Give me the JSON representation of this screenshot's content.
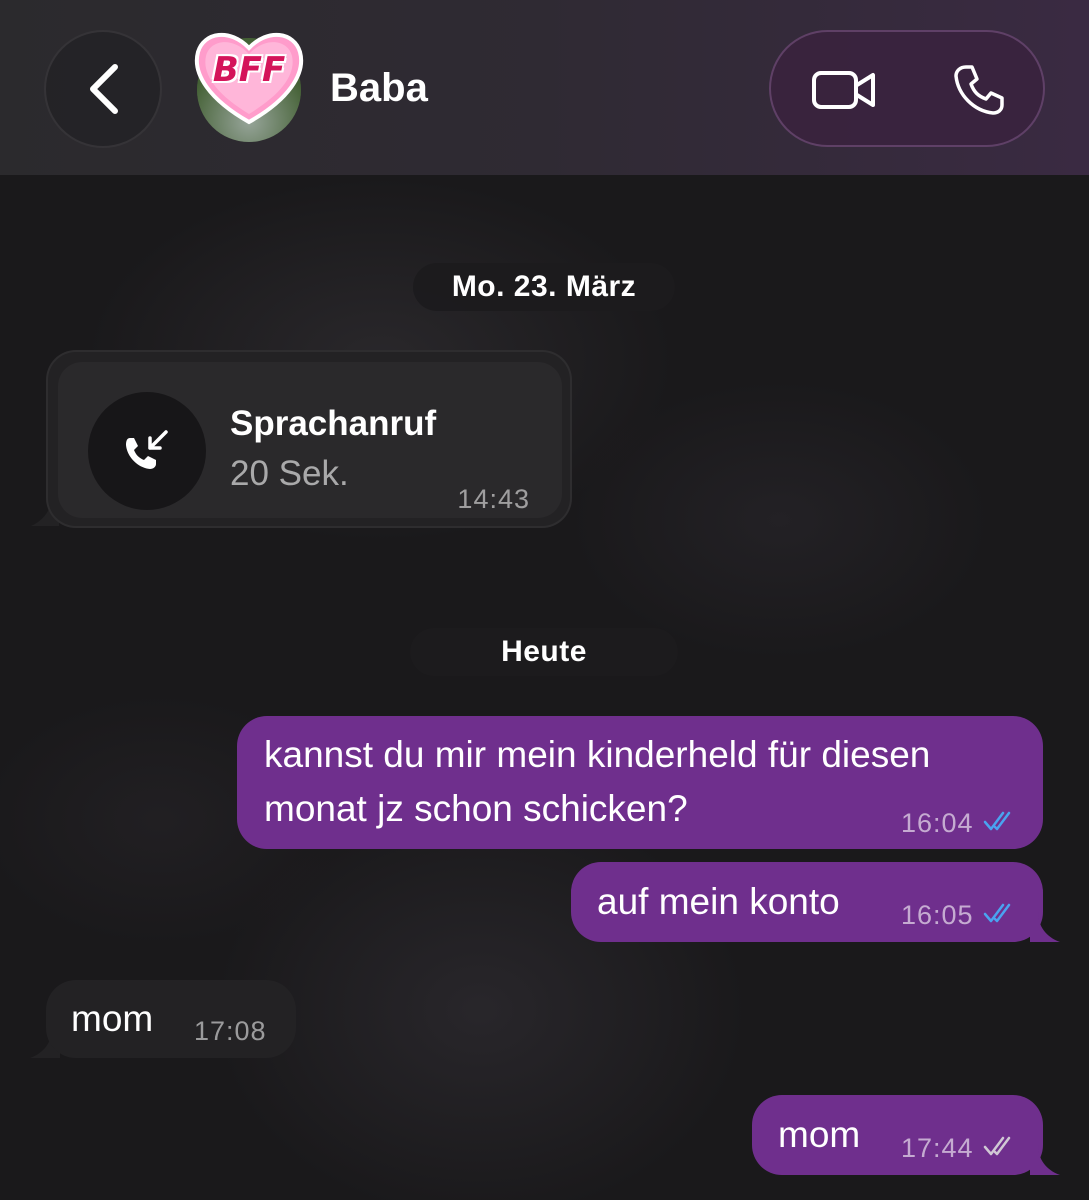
{
  "header": {
    "contact_name": "Baba",
    "avatar_badge_text": "BFF"
  },
  "dates": {
    "first": "Mo. 23. März",
    "second": "Heute"
  },
  "call": {
    "title": "Sprachanruf",
    "duration": "20 Sek.",
    "time": "14:43"
  },
  "messages": [
    {
      "direction": "out",
      "line1": "kannst du mir mein kinderheld für diesen",
      "line2": "monat jz schon schicken?",
      "time": "16:04",
      "status": "read"
    },
    {
      "direction": "out",
      "text": "auf mein konto",
      "time": "16:05",
      "status": "read"
    },
    {
      "direction": "in",
      "text": "mom",
      "time": "17:08"
    },
    {
      "direction": "out",
      "text": "mom",
      "time": "17:44",
      "status": "delivered"
    }
  ],
  "colors": {
    "outgoing_bubble": "#6f2f8d",
    "incoming_bubble": "#232224",
    "read_ticks": "#4aa3f0",
    "delivered_ticks": "#d0c8d4"
  }
}
